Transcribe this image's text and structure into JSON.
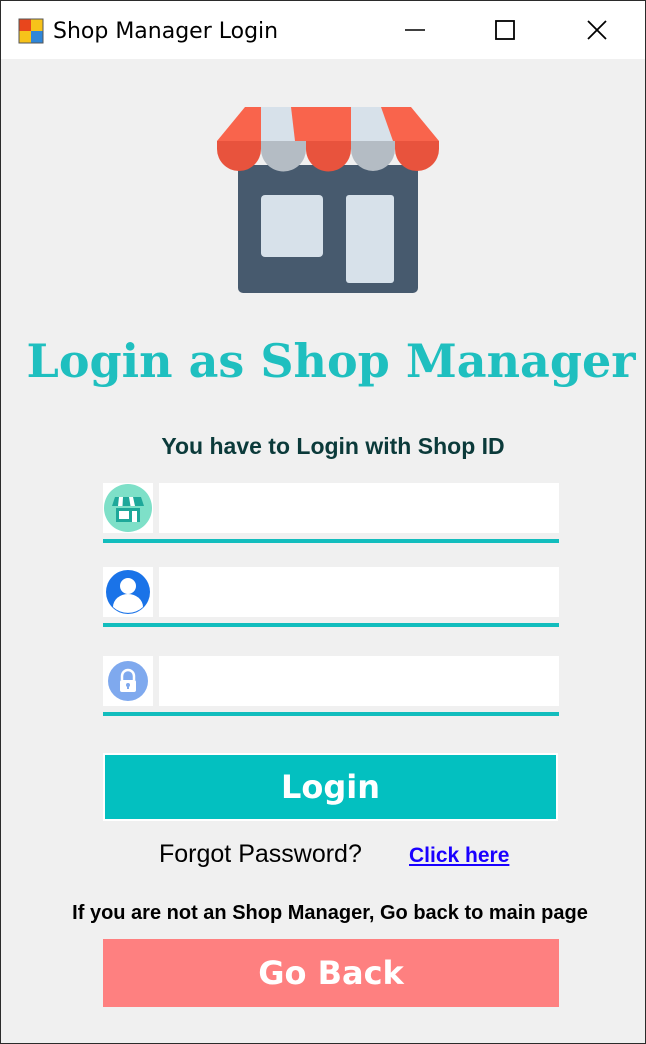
{
  "window": {
    "title": "Shop Manager Login",
    "icon": "windows-forms-app-icon"
  },
  "header": {
    "logo_icon": "shop-storefront-icon",
    "title": "Login as Shop Manager",
    "subtitle": "You have to Login with Shop ID"
  },
  "form": {
    "shop_id": {
      "icon": "shop-icon",
      "value": "",
      "placeholder": ""
    },
    "username": {
      "icon": "user-icon",
      "value": "",
      "placeholder": ""
    },
    "password": {
      "icon": "lock-icon",
      "value": "",
      "placeholder": ""
    },
    "login_label": "Login"
  },
  "forgot": {
    "label": "Forgot Password?",
    "link": "Click here"
  },
  "footer": {
    "notice": "If you are not an Shop Manager, Go back to main page",
    "go_back_label": "Go Back"
  },
  "colors": {
    "accent": "#03c0c0",
    "heading": "#1fbfbf",
    "danger": "#fe8080",
    "link": "#1a00ff"
  }
}
